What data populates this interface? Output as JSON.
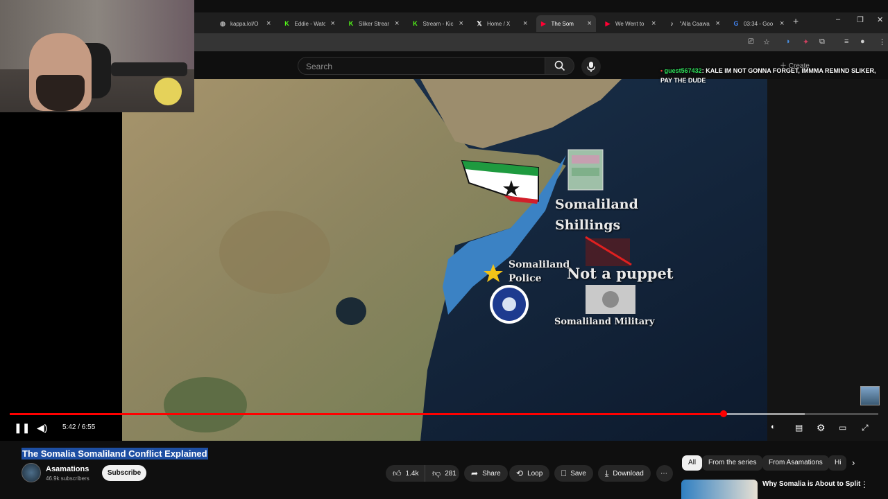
{
  "browser": {
    "tabs": [
      {
        "title": "kappa.lol/O",
        "icon": "globe-icon",
        "active": false
      },
      {
        "title": "Eddie - Watc",
        "icon": "kick-icon",
        "active": false
      },
      {
        "title": "Sliker Strean",
        "icon": "kick-icon",
        "active": false
      },
      {
        "title": "Stream - Kic",
        "icon": "kick-icon",
        "active": false
      },
      {
        "title": "Home / X",
        "icon": "x-icon",
        "active": false
      },
      {
        "title": "The Som",
        "icon": "youtube-icon",
        "active": true
      },
      {
        "title": "We Went to",
        "icon": "youtube-icon",
        "active": false
      },
      {
        "title": "\"Alla Caawa",
        "icon": "tiktok-icon",
        "active": false
      },
      {
        "title": "03:34 - Goo",
        "icon": "google-icon",
        "active": false
      }
    ],
    "colors": {
      "chrome": "#1f1f1f",
      "active_tab": "#353535"
    }
  },
  "youtube": {
    "search_placeholder": "Search",
    "create_label": "Create"
  },
  "chat_overlay": {
    "user": "guest567432",
    "message": ": KALE IM NOT GONNA FORGET, IMMMA REMIND SLIKER, PAY THE DUDE"
  },
  "video": {
    "map_labels": {
      "shillings": "Somaliland Shillings",
      "puppet": "Not a puppet",
      "police": "Somaliland Police",
      "military": "Somaliland Military"
    },
    "time_current": "5:42",
    "time_total": "6:55",
    "time_display": "5:42 / 6:55",
    "progress_fraction": 0.822,
    "buffered_fraction": 0.915,
    "accent_color": "#ff0000"
  },
  "meta": {
    "title": "The Somalia Somaliland Conflict Explained",
    "channel": "Asamations",
    "subscribers": "46.9k subscribers",
    "subscribe_label": "Subscribe",
    "likes": "1.4k",
    "dislikes": "281",
    "share_label": "Share",
    "loop_label": "Loop",
    "save_label": "Save",
    "download_label": "Download"
  },
  "sidebar": {
    "chips": [
      "All",
      "From the series",
      "From Asamations",
      "Hi"
    ],
    "recommended_title": "Why Somalia is About to Split"
  }
}
